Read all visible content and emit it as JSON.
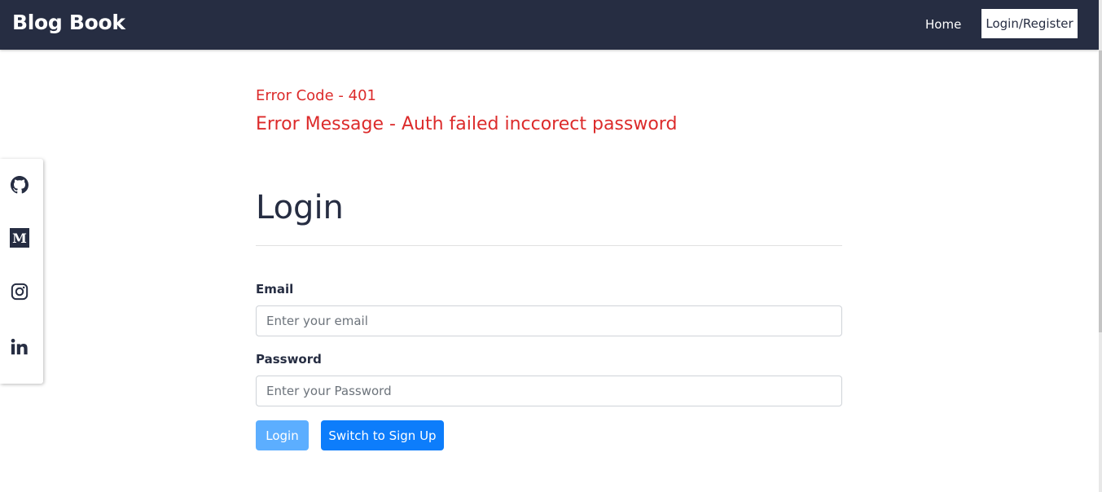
{
  "navbar": {
    "brand": "Blog Book",
    "links": [
      {
        "label": "Home"
      },
      {
        "label": "Login/Register"
      }
    ],
    "background": "#262d42"
  },
  "social": {
    "icons": [
      "github-icon",
      "medium-icon",
      "instagram-icon",
      "linkedin-icon"
    ]
  },
  "error": {
    "code": "Error Code - 401",
    "message": "Error Message - Auth failed inccorect password",
    "color": "#dc2b2b"
  },
  "login": {
    "title": "Login",
    "email": {
      "label": "Email",
      "value": "",
      "placeholder": "Enter your email"
    },
    "password": {
      "label": "Password",
      "value": "",
      "placeholder": "Enter your Password"
    },
    "buttons": {
      "login": "Login",
      "switch": "Switch to Sign Up"
    },
    "colors": {
      "login_button": "#5caeff",
      "switch_button": "#0d7dfb"
    }
  }
}
